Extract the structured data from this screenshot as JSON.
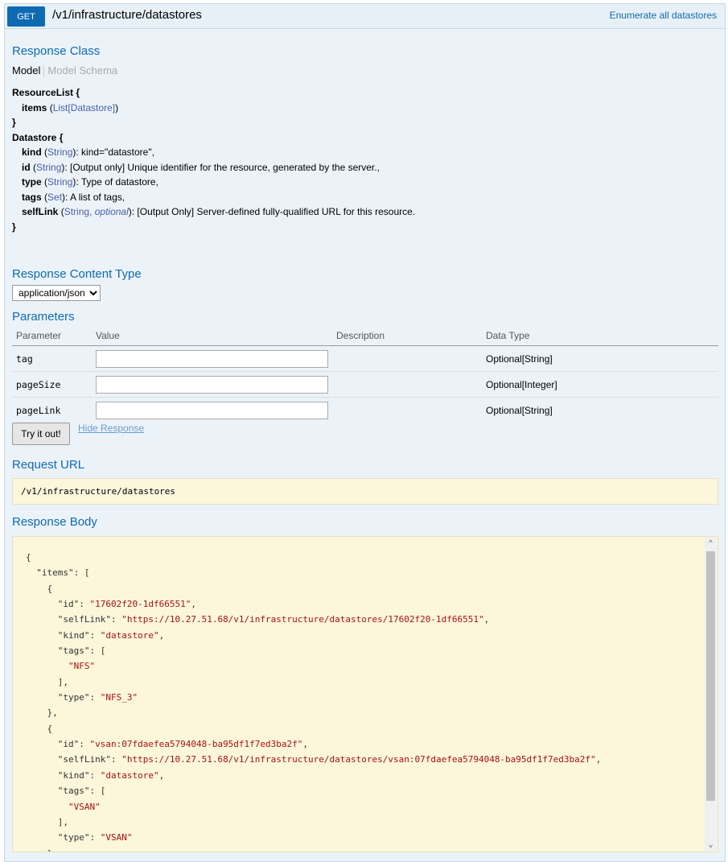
{
  "heading": {
    "method": "GET",
    "path": "/v1/infrastructure/datastores",
    "summary": "Enumerate all datastores"
  },
  "response_class": {
    "title": "Response Class",
    "tab_model": "Model",
    "tab_schema": "Model Schema",
    "model_lines": [
      "ResourceList {",
      "items (List[Datastore])",
      "}",
      "Datastore {",
      "kind (String): kind=\"datastore\",",
      "id (String): [Output only] Unique identifier for the resource, generated by the server.,",
      "type (String): Type of datastore,",
      "tags (Set): A list of tags,",
      "selfLink (String, optional): [Output Only] Server-defined fully-qualified URL for this resource.",
      "}"
    ]
  },
  "response_content_type": {
    "title": "Response Content Type",
    "selected": "application/json"
  },
  "parameters": {
    "title": "Parameters",
    "headers": [
      "Parameter",
      "Value",
      "Description",
      "Data Type"
    ],
    "rows": [
      {
        "name": "tag",
        "value": "",
        "description": "",
        "data_type": "Optional[String]"
      },
      {
        "name": "pageSize",
        "value": "",
        "description": "",
        "data_type": "Optional[Integer]"
      },
      {
        "name": "pageLink",
        "value": "",
        "description": "",
        "data_type": "Optional[String]"
      }
    ]
  },
  "actions": {
    "try_label": "Try it out!",
    "hide_label": "Hide Response"
  },
  "request_url": {
    "title": "Request URL",
    "value": "/v1/infrastructure/datastores"
  },
  "response_body": {
    "title": "Response Body",
    "text": "{\n  \"items\": [\n    {\n      \"id\": \"17602f20-1df66551\",\n      \"selfLink\": \"https://10.27.51.68/v1/infrastructure/datastores/17602f20-1df66551\",\n      \"kind\": \"datastore\",\n      \"tags\": [\n        \"NFS\"\n      ],\n      \"type\": \"NFS_3\"\n    },\n    {\n      \"id\": \"vsan:07fdaefea5794048-ba95df1f7ed3ba2f\",\n      \"selfLink\": \"https://10.27.51.68/v1/infrastructure/datastores/vsan:07fdaefea5794048-ba95df1f7ed3ba2f\",\n      \"kind\": \"datastore\",\n      \"tags\": [\n        \"VSAN\"\n      ],\n      \"type\": \"VSAN\"\n    },"
  },
  "colors": {
    "method_bg": "#0f6ab4",
    "heading_text": "#0f6ab4",
    "panel_bg": "#ebf3f9",
    "code_bg": "#fcf6db",
    "string_color": "#a11"
  }
}
